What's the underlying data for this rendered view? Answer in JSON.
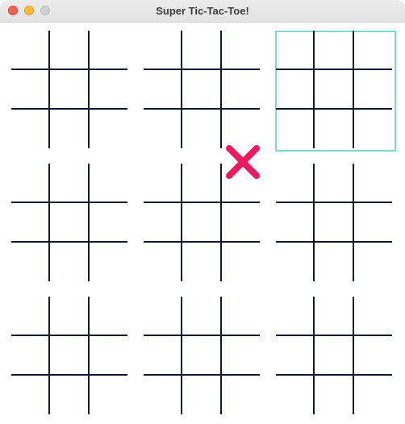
{
  "window": {
    "title": "Super Tic-Tac-Toe!"
  },
  "colors": {
    "grid_line": "#0e1a2b",
    "active_highlight": "#7fd8cf",
    "x_mark": "#f2175e"
  },
  "board": {
    "active_subboard": 2,
    "marks": [
      {
        "subboard": 4,
        "cell": 2,
        "symbol": "X"
      }
    ]
  }
}
